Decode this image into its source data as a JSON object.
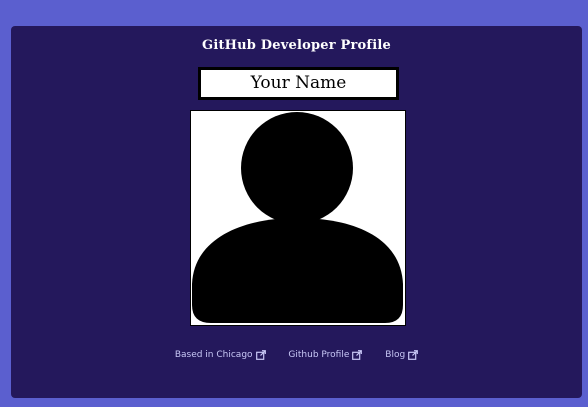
{
  "card": {
    "title": "GitHub Developer Profile",
    "name": "Your Name"
  },
  "avatar": {
    "icon": "user-silhouette-icon"
  },
  "links": [
    {
      "label": "Based in Chicago",
      "icon": "external-link-icon"
    },
    {
      "label": "Github Profile",
      "icon": "external-link-icon"
    },
    {
      "label": "Blog",
      "icon": "external-link-icon"
    }
  ],
  "colors": {
    "page_background": "#5b5fcf",
    "card_background": "#24185c",
    "title_text": "#ffffff",
    "link_text": "#c8c8f6"
  }
}
